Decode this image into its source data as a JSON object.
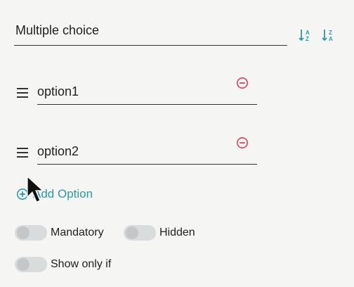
{
  "question": {
    "title": "Multiple choice"
  },
  "sort": {
    "asc_icon": "sort-alpha-asc-icon",
    "desc_icon": "sort-alpha-desc-icon"
  },
  "options": [
    {
      "label": "option1"
    },
    {
      "label": "option2"
    }
  ],
  "add_option": {
    "label": "Add Option"
  },
  "toggles": {
    "mandatory": {
      "label": "Mandatory",
      "on": false
    },
    "hidden": {
      "label": "Hidden",
      "on": false
    },
    "show_only_if": {
      "label": "Show only if",
      "on": false
    }
  },
  "colors": {
    "accent": "#2a9aa6",
    "remove": "#d9445a"
  }
}
